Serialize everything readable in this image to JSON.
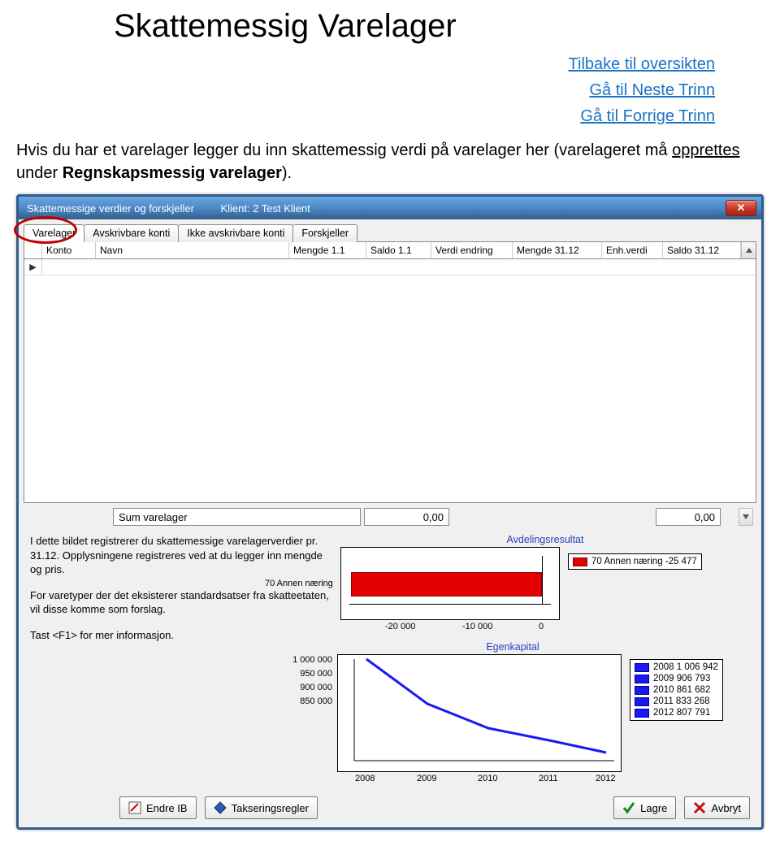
{
  "page": {
    "title": "Skattemessig Varelager",
    "nav": {
      "overview": "Tilbake til oversikten",
      "next": "Gå til Neste Trinn",
      "prev": "Gå til Forrige Trinn"
    },
    "body_pre": "Hvis du har et varelager legger du inn skattemessig verdi på varelager her (varelageret må ",
    "body_under": "opprettes ",
    "body_post": "under ",
    "body_bold": "Regnskapsmessig varelager",
    "body_tail": ")."
  },
  "dialog": {
    "title": "Skattemessige verdier og forskjeller",
    "client": "Klient: 2 Test Klient",
    "close_x": "✕",
    "tabs": [
      "Varelager",
      "Avskrivbare konti",
      "Ikke avskrivbare konti",
      "Forskjeller"
    ],
    "columns": [
      "Konto",
      "Navn",
      "Mengde 1.1",
      "Saldo 1.1",
      "Verdi endring",
      "Mengde 31.12",
      "Enh.verdi",
      "Saldo 31.12"
    ],
    "row_marker": "▶",
    "sum": {
      "label": "Sum varelager",
      "mid": "0,00",
      "right": "0,00"
    },
    "info": {
      "p1": "I dette bildet registrerer du skattemessige varelagerverdier pr. 31.12. Opplysningene registreres ved at du legger inn mengde og pris.",
      "p2": "For varetyper der det eksisterer standardsatser fra skatteetaten, vil disse komme som forslag.",
      "p3": "Tast <F1> for mer informasjon."
    },
    "buttons": {
      "endre": "Endre IB",
      "takser": "Takseringsregler",
      "lagre": "Lagre",
      "avbryt": "Avbryt"
    }
  },
  "chart_data": [
    {
      "type": "bar",
      "title": "Avdelingsresultat",
      "orientation": "horizontal",
      "categories": [
        "70 Annen næring"
      ],
      "values": [
        -25477
      ],
      "x_ticks": [
        -20000,
        -10000,
        0
      ],
      "x_tick_labels": [
        "-20 000",
        "-10 000",
        "0"
      ],
      "legend": [
        "70 Annen næring -25 477"
      ],
      "colors": [
        "#e30000"
      ]
    },
    {
      "type": "line",
      "title": "Egenkapital",
      "x": [
        2008,
        2009,
        2010,
        2011,
        2012
      ],
      "y_ticks": [
        850000,
        900000,
        950000,
        1000000
      ],
      "y_tick_labels": [
        "850 000",
        "900 000",
        "950 000",
        "1 000 000"
      ],
      "series": [
        {
          "name": "Egenkapital",
          "values": [
            1006942,
            906793,
            861682,
            833268,
            807791
          ]
        }
      ],
      "legend": [
        {
          "label": "2008 1 006 942"
        },
        {
          "label": "2009    906 793"
        },
        {
          "label": "2010    861 682"
        },
        {
          "label": "2011    833 268"
        },
        {
          "label": "2012    807 791"
        }
      ],
      "colors": [
        "#1a1af0"
      ]
    }
  ]
}
